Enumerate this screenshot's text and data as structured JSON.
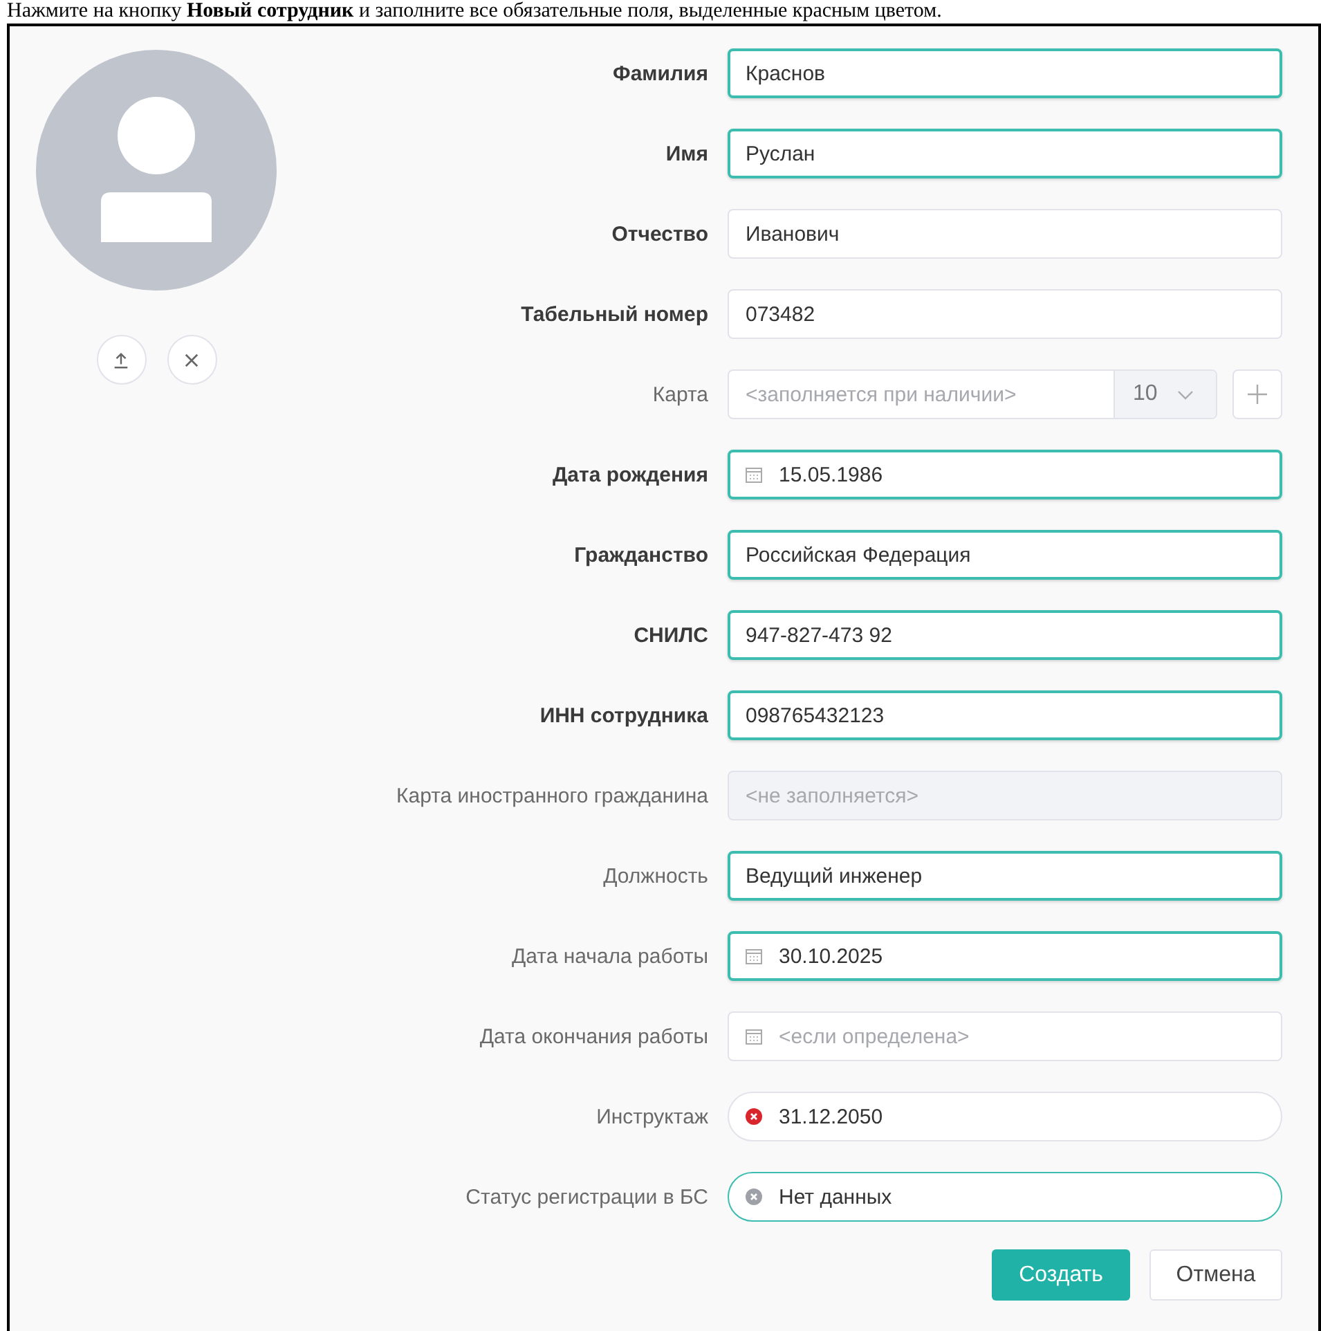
{
  "instruction": "Нажмите на кнопку **Новый сотрудник** и заполните все обязательные поля, выделенные красным цветом.",
  "fields": [
    {
      "label": "Фамилия",
      "bold": true,
      "kind": "text",
      "value": "Краснов",
      "highlighted": true
    },
    {
      "label": "Имя",
      "bold": true,
      "kind": "text",
      "value": "Руслан",
      "highlighted": true
    },
    {
      "label": "Отчество",
      "bold": true,
      "kind": "text",
      "value": "Иванович",
      "highlighted": false
    },
    {
      "label": "Табельный номер",
      "bold": true,
      "kind": "text",
      "value": "073482",
      "highlighted": false
    },
    {
      "label": "Карта",
      "bold": false,
      "kind": "card",
      "placeholder": "<заполняется при наличии>",
      "select_value": "10",
      "highlighted": false
    },
    {
      "label": "Дата рождения",
      "bold": true,
      "kind": "date",
      "value": "15.05.1986",
      "highlighted": true
    },
    {
      "label": "Гражданство",
      "bold": true,
      "kind": "text",
      "value": "Российская Федерация",
      "highlighted": true
    },
    {
      "label": "СНИЛС",
      "bold": true,
      "kind": "text",
      "value": "947-827-473 92",
      "highlighted": true
    },
    {
      "label": "ИНН сотрудника",
      "bold": true,
      "kind": "text",
      "value": "098765432123",
      "highlighted": true
    },
    {
      "label": "Карта иностранного гражданина",
      "bold": false,
      "kind": "disabled",
      "placeholder": "<не заполняется>",
      "highlighted": false
    },
    {
      "label": "Должность",
      "bold": false,
      "kind": "text",
      "value": "Ведущий инженер",
      "highlighted": true
    },
    {
      "label": "Дата начала работы",
      "bold": false,
      "kind": "date",
      "value": "30.10.2025",
      "highlighted": true
    },
    {
      "label": "Дата окончания работы",
      "bold": false,
      "kind": "date",
      "placeholder": "<если определена>",
      "highlighted": false
    },
    {
      "label": "Инструктаж",
      "bold": false,
      "kind": "status",
      "value": "31.12.2050",
      "color": "#d9262c",
      "highlighted": false
    },
    {
      "label": "Статус регистрации в БС",
      "bold": false,
      "kind": "status",
      "value": "Нет данных",
      "color": "#9ea1a8",
      "highlighted": true
    }
  ],
  "buttons": [
    {
      "label": "Создать",
      "kind": "primary"
    },
    {
      "label": "Отмена",
      "kind": "secondary"
    }
  ]
}
